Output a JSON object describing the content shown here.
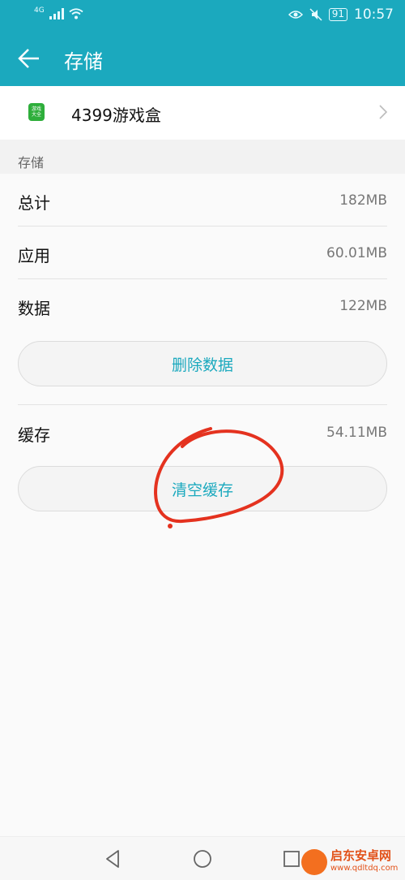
{
  "status_bar": {
    "network": "4G",
    "battery": "91",
    "time": "10:57",
    "icons": [
      "signal-icon",
      "wifi-icon",
      "eye-icon",
      "mute-icon",
      "battery-icon"
    ]
  },
  "app_bar": {
    "back_icon": "back-arrow-icon",
    "title": "存储",
    "background_color": "#1ba9be"
  },
  "app_row": {
    "icon_text_top": "游戏",
    "icon_text_bottom": "大全",
    "name": "4399游戏盒",
    "chevron_icon": "chevron-right-icon"
  },
  "section": {
    "header": "存储"
  },
  "storage": {
    "rows": [
      {
        "label": "总计",
        "value": "182MB"
      },
      {
        "label": "应用",
        "value": "60.01MB"
      },
      {
        "label": "数据",
        "value": "122MB"
      }
    ],
    "delete_data_button": "删除数据",
    "cache": {
      "label": "缓存",
      "value": "54.11MB"
    },
    "clear_cache_button": "清空缓存"
  },
  "annotation": {
    "shape": "hand-drawn-circle",
    "color": "#e4321f",
    "target": "clear_cache_button"
  },
  "nav_bar": {
    "icons": [
      "back-triangle-icon",
      "home-circle-icon",
      "recents-square-icon"
    ]
  },
  "watermark": {
    "name": "启东安卓网",
    "url": "www.qdltdq.com"
  }
}
